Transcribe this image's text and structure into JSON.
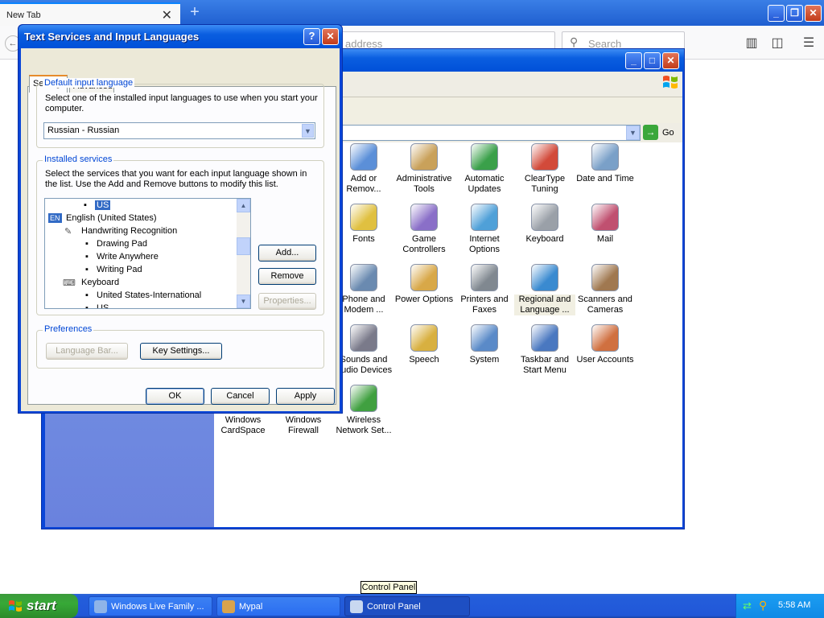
{
  "browser": {
    "tab_title": "New Tab",
    "tab_close": "✕",
    "new_tab": "+",
    "url_placeholder": "address",
    "search_placeholder": "Search"
  },
  "control_panel": {
    "address_go": "Go",
    "icons": [
      {
        "label": "Add or Remov...",
        "icon": "add-remove-programs-icon"
      },
      {
        "label": "Administrative Tools",
        "icon": "admin-tools-icon"
      },
      {
        "label": "Automatic Updates",
        "icon": "automatic-updates-icon"
      },
      {
        "label": "ClearType Tuning",
        "icon": "cleartype-icon"
      },
      {
        "label": "Date and Time",
        "icon": "date-time-icon"
      },
      {
        "label": "Fonts",
        "icon": "fonts-icon"
      },
      {
        "label": "Game Controllers",
        "icon": "game-controllers-icon"
      },
      {
        "label": "Internet Options",
        "icon": "internet-options-icon"
      },
      {
        "label": "Keyboard",
        "icon": "keyboard-icon"
      },
      {
        "label": "Mail",
        "icon": "mail-icon"
      },
      {
        "label": "Phone and Modem ...",
        "icon": "phone-modem-icon"
      },
      {
        "label": "Power Options",
        "icon": "power-options-icon"
      },
      {
        "label": "Printers and Faxes",
        "icon": "printers-icon"
      },
      {
        "label": "Regional and Language ...",
        "icon": "regional-language-icon"
      },
      {
        "label": "Scanners and Cameras",
        "icon": "scanners-icon"
      },
      {
        "label": "Sounds and Audio Devices",
        "icon": "sounds-icon"
      },
      {
        "label": "Speech",
        "icon": "speech-icon"
      },
      {
        "label": "System",
        "icon": "system-icon"
      },
      {
        "label": "Taskbar and Start Menu",
        "icon": "taskbar-icon"
      },
      {
        "label": "User Accounts",
        "icon": "user-accounts-icon"
      },
      {
        "label": "Windows CardSpace",
        "icon": "cardspace-icon"
      },
      {
        "label": "Windows Firewall",
        "icon": "firewall-icon"
      },
      {
        "label": "Wireless Network Set...",
        "icon": "wireless-icon"
      }
    ]
  },
  "dialog": {
    "title": "Text Services and Input Languages",
    "help": "?",
    "close": "✕",
    "tabs": [
      "Settings",
      "Advanced"
    ],
    "default_lang": {
      "heading": "Default input language",
      "description": "Select one of the installed input languages to use when you start your computer.",
      "selected": "Russian - Russian"
    },
    "installed": {
      "heading": "Installed services",
      "description": "Select the services that you want for each input language shown in the list. Use the Add and Remove buttons to modify this list.",
      "tree": [
        "US",
        "English (United States)",
        "Handwriting Recognition",
        "Drawing Pad",
        "Write Anywhere",
        "Writing Pad",
        "Keyboard",
        "United States-International",
        "US"
      ],
      "lang_badge": "EN",
      "add": "Add...",
      "remove": "Remove",
      "properties": "Properties..."
    },
    "preferences": {
      "heading": "Preferences",
      "language_bar": "Language Bar...",
      "key_settings": "Key Settings..."
    },
    "ok": "OK",
    "cancel": "Cancel",
    "apply": "Apply"
  },
  "taskbar": {
    "start": "start",
    "items": [
      "Windows Live Family ...",
      "Mypal",
      "Control Panel"
    ],
    "tooltip": "Control Panel",
    "clock": "5:58 AM"
  }
}
